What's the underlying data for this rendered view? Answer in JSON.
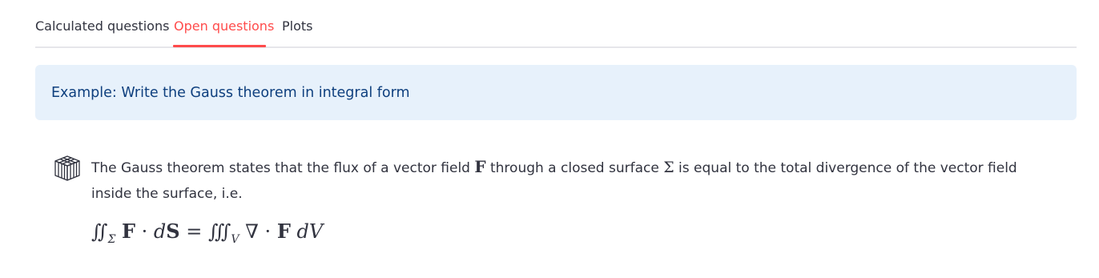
{
  "tabs": [
    {
      "label": "Calculated questions",
      "active": false
    },
    {
      "label": "Open questions",
      "active": true
    },
    {
      "label": "Plots",
      "active": false
    }
  ],
  "alert": {
    "text": "Example: Write the Gauss theorem in integral form"
  },
  "answer": {
    "icon": "cube-icon",
    "text_part1": "The Gauss theorem states that the flux of a vector field ",
    "symbol_F": "F",
    "text_part2": " through a closed surface ",
    "symbol_sigma": "Σ",
    "text_part3": " is equal to the total divergence of the vector field inside the surface, i.e.",
    "formula": {
      "lhs_integral": "∬",
      "lhs_sub": "Σ",
      "lhs_body_F": "F",
      "lhs_dot": " · ",
      "lhs_d": "d",
      "lhs_S": "S",
      "equals": " = ",
      "rhs_integral": "∭",
      "rhs_sub": "V",
      "rhs_nabla": "∇",
      "rhs_dot": " · ",
      "rhs_F": "F",
      "rhs_dV": "dV"
    }
  },
  "colors": {
    "accent": "#ff4b4b",
    "alert_bg": "#e7f1fb",
    "alert_text": "#0e3f7e",
    "text": "#31333f",
    "divider": "#e6e6ea"
  }
}
